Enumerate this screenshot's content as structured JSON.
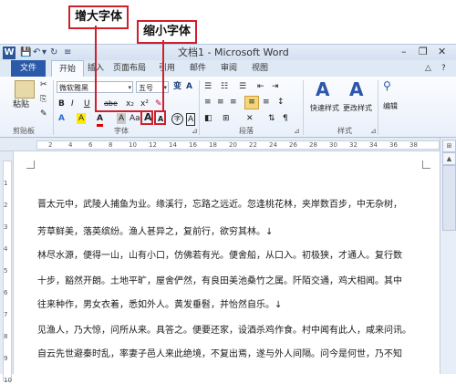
{
  "callouts": {
    "enlarge_font": "增大字体",
    "shrink_font": "缩小字体"
  },
  "titlebar": {
    "title": "文档1 - Microsoft Word",
    "app_icon": "W",
    "qat_save": "💾",
    "qat_undo": "↶",
    "qat_undo_dd": "▾",
    "qat_redo": "↻",
    "qat_extra": "≡",
    "win_minimize": "–",
    "win_restore": "❐",
    "win_close": "✕"
  },
  "tabs": [
    "文件",
    "开始",
    "插入",
    "页面布局",
    "引用",
    "邮件",
    "审阅",
    "视图"
  ],
  "tabbar_icons": {
    "collapse": "△",
    "help": "?"
  },
  "ribbon": {
    "paste_label": "粘贴",
    "font_name": "微软雅黑",
    "font_size": "五号",
    "font_btn_wen": "变",
    "font_btn_A": "A",
    "bold": "B",
    "italic": "I",
    "underline": "U",
    "strike": "abe",
    "subscript": "x₂",
    "superscript": "x²",
    "highlight": "A",
    "fontcolor": "A",
    "grow_font": "A",
    "shrink_font": "A",
    "clear_format": "A",
    "enclose": "字",
    "styles_quick": "快速样式",
    "styles_change": "更改样式",
    "editing": "编辑",
    "group_clipboard": "剪贴板",
    "group_font": "字体",
    "group_paragraph": "段落",
    "group_styles": "样式",
    "dialog_launcher": "⊿"
  },
  "ruler": {
    "h_marks": [
      "2",
      "4",
      "6",
      "8",
      "10",
      "12",
      "14",
      "16",
      "18",
      "20",
      "22",
      "24",
      "26",
      "28",
      "30",
      "32",
      "34",
      "36",
      "38"
    ],
    "v_marks": [
      "1",
      "2",
      "3",
      "4",
      "5",
      "6",
      "7",
      "8",
      "9",
      "10"
    ]
  },
  "document": {
    "lines": [
      "晋太元中，武陵人捕鱼为业。缘溪行，忘路之远近。忽逢桃花林，夹岸数百步，中无杂树，",
      "芳草鲜美，落英缤纷。渔人甚异之，复前行，欲穷其林。↓",
      "林尽水源，便得一山，山有小口，仿佛若有光。便舍船，从口入。初极狭，才通人。复行数",
      "十步，豁然开朗。土地平旷，屋舍俨然，有良田美池桑竹之属。阡陌交通，鸡犬相闻。其中",
      "往来种作，男女衣着，悉如外人。黄发垂髫，并怡然自乐。↓",
      "见渔人，乃大惊，问所从来。具答之。便要还家，设酒杀鸡作食。村中闻有此人，咸来问讯。",
      "自云先世避秦时乱，率妻子邑人来此绝境，不复出焉，遂与外人间隔。问今是何世，乃不知"
    ]
  },
  "colors": {
    "callout_red": "#d0202c",
    "file_tab": "#2b5aa8",
    "ribbon_bg": "#e9f0fa"
  }
}
